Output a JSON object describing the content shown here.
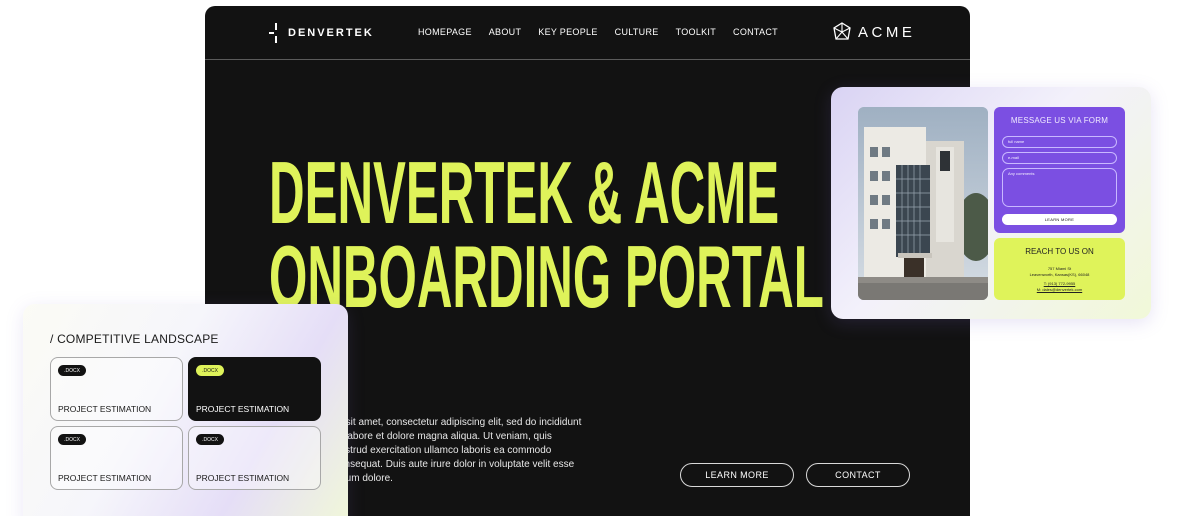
{
  "header": {
    "brand": "DENVERTEK",
    "nav": [
      "HOMEPAGE",
      "ABOUT",
      "KEY PEOPLE",
      "CULTURE",
      "TOOLKIT",
      "CONTACT"
    ],
    "partner": "ACME"
  },
  "hero": {
    "title_line1": "DENVERTEK & ACME",
    "title_line2": "ONBOARDING PORTAL",
    "body": "or sit amet, consectetur adipiscing elit, sed do incididunt ut labore et dolore magna aliqua. Ut veniam, quis nostrud exercitation ullamco laboris ea commodo consequat. Duis aute irure dolor in voluptate velit esse cillum dolore.",
    "learn_more": "LEARN MORE",
    "contact": "CONTACT"
  },
  "contact_card": {
    "form_title": "MESSAGE US VIA FORM",
    "name_placeholder": "full name",
    "email_placeholder": "e-mail",
    "comments_placeholder": "Any comments",
    "submit": "LEARN MORE",
    "reach_title": "REACH TO US ON",
    "address_line1": "757 Miami St",
    "address_line2": "Leavenworth, Kansas(KS), 66048",
    "phone": "T: (913) 772-9955",
    "email": "M: dales@denvertek.com"
  },
  "landscape": {
    "title": "/ COMPETITIVE LANDSCAPE",
    "tiles": [
      {
        "tag": ".DOCX",
        "label": "PROJECT ESTIMATION"
      },
      {
        "tag": ".DOCX",
        "label": "PROJECT ESTIMATION"
      },
      {
        "tag": ".DOCX",
        "label": "PROJECT ESTIMATION"
      },
      {
        "tag": ".DOCX",
        "label": "PROJECT ESTIMATION"
      }
    ]
  },
  "colors": {
    "accent_lime": "#dff35a",
    "accent_purple": "#7b4fe2",
    "background_dark": "#121212"
  }
}
